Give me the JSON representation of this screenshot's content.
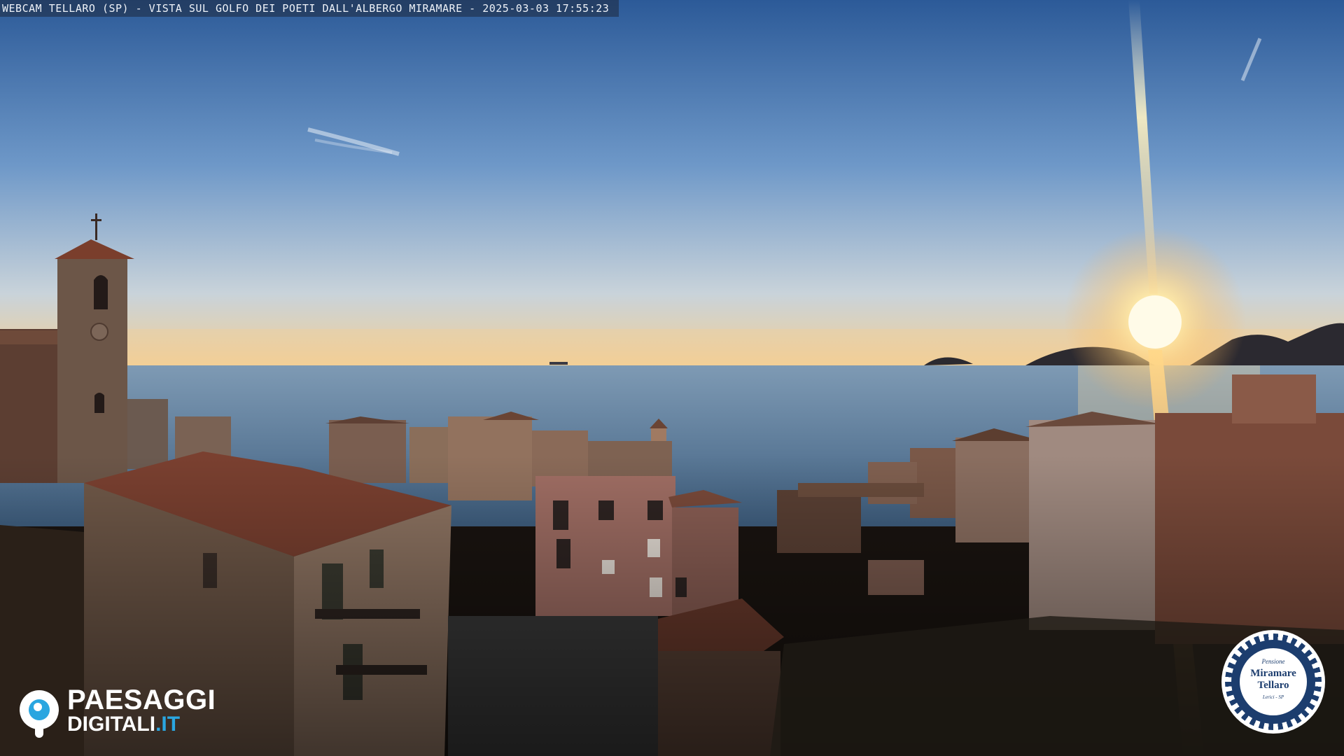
{
  "caption": {
    "text": "WEBCAM TELLARO (SP) - VISTA SUL GOLFO DEI POETI DALL'ALBERGO MIRAMARE - 2025-03-03 17:55:23"
  },
  "watermark_left": {
    "line1": "PAESAGGI",
    "line2": "DIGITALI",
    "line2_suffix": ".IT",
    "icon": "eye-pin-icon",
    "accent": "#2aa6e0"
  },
  "watermark_right": {
    "top": "Pensione",
    "name1": "Miramare",
    "name2": "Tellaro",
    "bottom": "Lerici - SP",
    "color": "#1c3d6e"
  },
  "colors": {
    "sky_top": "#2f5f9e",
    "sky_mid": "#7fa6cf",
    "horizon": "#f2c98a",
    "sea": "#5b7fa0",
    "sun": "#fff6c8"
  }
}
